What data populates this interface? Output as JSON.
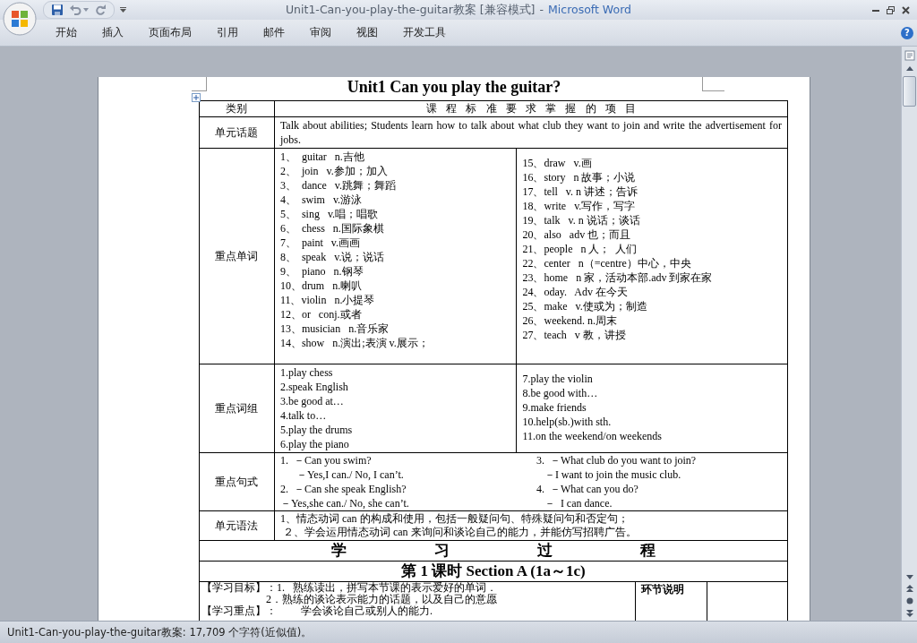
{
  "window": {
    "title": "Unit1-Can-you-play-the-guitar教案 [兼容模式]",
    "separator": "-",
    "app": "Microsoft Word"
  },
  "ribbon": {
    "tabs": [
      {
        "label": "开始",
        "selected": false
      },
      {
        "label": "插入",
        "selected": false
      },
      {
        "label": "页面布局",
        "selected": false
      },
      {
        "label": "引用",
        "selected": false
      },
      {
        "label": "邮件",
        "selected": false
      },
      {
        "label": "审阅",
        "selected": false
      },
      {
        "label": "视图",
        "selected": false
      },
      {
        "label": "开发工具",
        "selected": false
      }
    ],
    "help": "?"
  },
  "document": {
    "title": "Unit1 Can you play the guitar?",
    "table": {
      "header": [
        "类别",
        "课 程 标 准 要 求 掌 握 的 项 目"
      ],
      "topic": {
        "label": "单元话题",
        "text": "Talk about abilities; Students learn how to talk about what club they want to join and write the advertisement for jobs."
      },
      "vocabulary": {
        "label": "重点单词",
        "left": [
          "1、  guitar   n.吉他",
          "2、  join   v.参加；加入",
          "3、  dance   v.跳舞；舞蹈",
          "4、  swim   v.游泳",
          "5、  sing   v.唱；唱歌",
          "6、  chess   n.国际象棋",
          "7、  paint   v.画画",
          "8、  speak   v.说；说话",
          "9、  piano   n.钢琴",
          "10、drum   n.喇叭",
          "11、violin   n.小提琴",
          "12、or   conj.或者",
          "13、musician   n.音乐家",
          "14、show   n.演出;表演 v.展示；"
        ],
        "right": [
          "15、draw   v.画",
          "16、story   n 故事；小说",
          "17、tell   v. n 讲述；告诉",
          "18、write   v.写作，写字",
          "19、talk   v. n 说话；谈话",
          "20、also   adv 也；而且",
          "21、people   n 人；  人们",
          "22、center   n（=centre）中心，中央",
          "23、home   n 家，活动本部.adv 到家在家",
          "24、oday.   Adv 在今天",
          "25、make   v.使或为；制造",
          "26、weekend. n.周末",
          "27、teach   v 教，讲授"
        ]
      },
      "phrases": {
        "label": "重点词组",
        "left": [
          "1.play chess",
          "2.speak English",
          "3.be good at…",
          "4.talk to…",
          "5.play the drums",
          "6.play the piano"
        ],
        "right": [
          "7.play the violin",
          "8.be good with…",
          "9.make friends",
          "10.help(sb.)with sth.",
          "11.on the weekend/on weekends"
        ]
      },
      "sentences": {
        "label": "重点句式",
        "left": [
          "1.  －Can you swim?",
          "      －Yes,I can./ No, I can’t.",
          "2.  －Can she speak English?",
          "－Yes,she can./ No, she can’t."
        ],
        "right": [
          "3.  －What club do you want to join?",
          "   －I want to join the music club.",
          "4.  －What can you do?",
          "   －  I can dance."
        ]
      },
      "grammar": {
        "label": "单元语法",
        "lines": [
          "1、情态动词 can 的构成和使用，包括一般疑问句、特殊疑问句和否定句；",
          " ２、学会运用情态动词 can 来询问和谈论自己的能力，并能仿写招聘广告。"
        ]
      },
      "process": "学 习 过 程",
      "lesson": "第 1 课时  Section A (1a～1c)",
      "objectives": {
        "lines": [
          "【学习目标】：1.   熟练读出，拼写本节课的表示爱好的单词．",
          "                        2．熟练的谈论表示能力的话题，以及自己的意愿",
          "【学习重点】：         学会谈论自己或别人的能力."
        ],
        "side_heading": "环节说明"
      }
    }
  },
  "status_bar": {
    "text": "Unit1-Can-you-play-the-guitar教案: 17,709 个字符(近似值)。"
  }
}
